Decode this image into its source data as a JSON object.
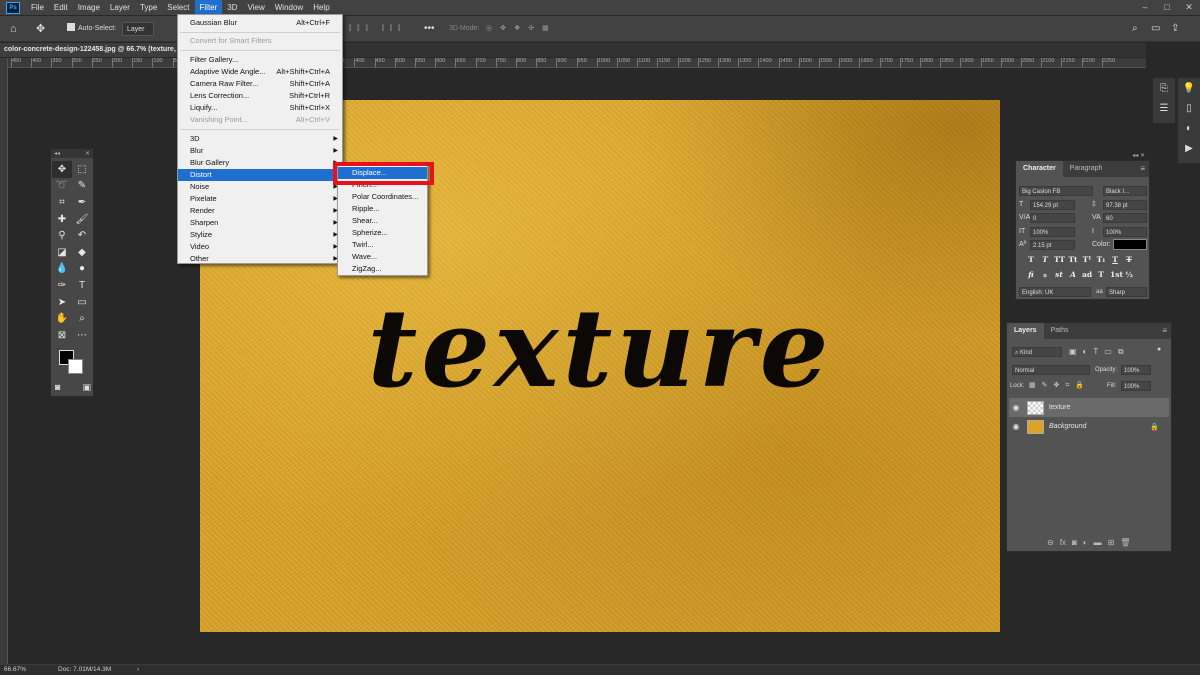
{
  "menubar": {
    "app_logo": "Ps",
    "items": [
      "File",
      "Edit",
      "Image",
      "Layer",
      "Type",
      "Select",
      "Filter",
      "3D",
      "View",
      "Window",
      "Help"
    ],
    "active_item": "Filter",
    "window_controls": [
      "–",
      "□",
      "✕"
    ]
  },
  "optionsbar": {
    "auto_select_label": "Auto-Select:",
    "auto_select_value": "Layer",
    "mode_3d": "3D Mode:"
  },
  "document": {
    "tab_title": "color-concrete-design-122458.jpg @ 66.7% (texture,",
    "canvas_text": "texture"
  },
  "ruler": {
    "horizontal_ticks": [
      "450",
      "400",
      "350",
      "300",
      "250",
      "200",
      "150",
      "100",
      "50",
      "0",
      "50",
      "100",
      "150",
      "200",
      "250",
      "300",
      "350",
      "400",
      "450",
      "500",
      "550",
      "600",
      "650",
      "700",
      "750",
      "800",
      "850",
      "900",
      "950",
      "1000",
      "1050",
      "1100",
      "1150",
      "1200",
      "1250",
      "1300",
      "1350",
      "1400",
      "1450",
      "1500",
      "1550",
      "1600",
      "1650",
      "1700",
      "1750",
      "1800",
      "1850",
      "1900",
      "1950",
      "2000",
      "2050",
      "2100",
      "2150",
      "2200",
      "2250"
    ]
  },
  "filter_menu": {
    "last_filter": {
      "label": "Gaussian Blur",
      "shortcut": "Alt+Ctrl+F"
    },
    "convert_smart": "Convert for Smart Filters",
    "group1": [
      {
        "label": "Filter Gallery...",
        "shortcut": ""
      },
      {
        "label": "Adaptive Wide Angle...",
        "shortcut": "Alt+Shift+Ctrl+A"
      },
      {
        "label": "Camera Raw Filter...",
        "shortcut": "Shift+Ctrl+A"
      },
      {
        "label": "Lens Correction...",
        "shortcut": "Shift+Ctrl+R"
      },
      {
        "label": "Liquify...",
        "shortcut": "Shift+Ctrl+X"
      },
      {
        "label": "Vanishing Point...",
        "shortcut": "Alt+Ctrl+V"
      }
    ],
    "submenus": [
      "3D",
      "Blur",
      "Blur Gallery",
      "Distort",
      "Noise",
      "Pixelate",
      "Render",
      "Sharpen",
      "Stylize",
      "Video",
      "Other"
    ],
    "highlighted": "Distort"
  },
  "distort_menu": {
    "items": [
      "Displace...",
      "Pinch...",
      "Polar Coordinates...",
      "Ripple...",
      "Shear...",
      "Spherize...",
      "Twirl...",
      "Wave...",
      "ZigZag..."
    ],
    "highlighted": "Displace..."
  },
  "character_panel": {
    "tabs": [
      "Character",
      "Paragraph"
    ],
    "font_family": "Big Caslon FB",
    "font_style": "Black I...",
    "font_size": "154.29 pt",
    "leading": "97.38 pt",
    "kerning": "0",
    "tracking": "60",
    "vertical_scale": "100%",
    "horizontal_scale": "100%",
    "baseline_shift": "2.15 pt",
    "color_label": "Color:",
    "color_value": "#000000",
    "type_buttons_row1": [
      "T",
      "T",
      "TT",
      "Tt",
      "T¹",
      "T₁",
      "T",
      "T"
    ],
    "type_buttons_row2": [
      "fi",
      "ℴ",
      "st",
      "A",
      "ad",
      "T",
      "1st",
      "½"
    ],
    "language": "English: UK",
    "antialias": "Sharp"
  },
  "layers_panel": {
    "tabs": [
      "Layers",
      "Paths"
    ],
    "kind_filter": "Kind",
    "blend_mode": "Normal",
    "opacity_label": "Opacity:",
    "opacity_value": "100%",
    "lock_label": "Lock:",
    "fill_label": "Fill:",
    "fill_value": "100%",
    "layers": [
      {
        "name": "texture",
        "type": "text",
        "selected": true
      },
      {
        "name": "Background",
        "type": "image",
        "selected": false
      }
    ]
  },
  "statusbar": {
    "zoom": "66.67%",
    "doc_info": "Doc: 7.01M/14.3M"
  }
}
